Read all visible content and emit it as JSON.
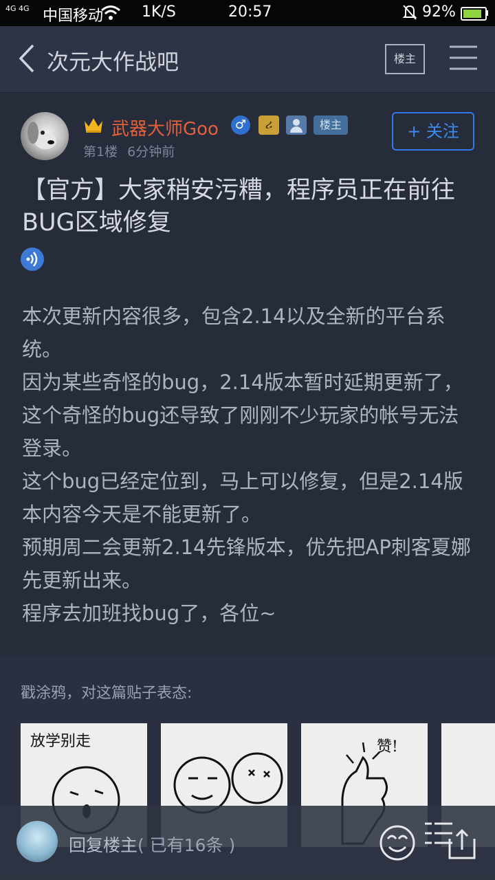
{
  "status_bar": {
    "signal": "4G 4G",
    "carrier": "中国移动",
    "speed": "1K/S",
    "time": "20:57",
    "battery": "92%"
  },
  "nav": {
    "title": "次元大作战吧",
    "louzhu_button": "楼主"
  },
  "post": {
    "author": "武器大师Goo",
    "badges": {
      "gender": "♂",
      "level": "ሪ",
      "louzhu": "楼主"
    },
    "floor": "第1楼",
    "time": "6分钟前",
    "follow_label": "+ 关注",
    "title": "【官方】大家稍安污糟，程序员正在前往BUG区域修复",
    "paragraphs": [
      "本次更新内容很多，包含2.14以及全新的平台系统。",
      "因为某些奇怪的bug，2.14版本暂时延期更新了，这个奇怪的bug还导致了刚刚不少玩家的帐号无法登录。",
      "这个bug已经定位到，马上可以修复，但是2.14版本内容今天是不能更新了。",
      "预期周二会更新2.14先锋版本，优先把AP刺客夏娜先更新出来。",
      "程序去加班找bug了，各位~"
    ]
  },
  "doodle": {
    "label": "戳涂鸦，对这篇贴子表态:",
    "stickers": [
      {
        "caption": "放学别走"
      },
      {
        "caption": ""
      },
      {
        "caption": "赞!"
      },
      {
        "caption": ""
      }
    ]
  },
  "reply_bar": {
    "label": "回复楼主",
    "count": "( 已有16条 )"
  }
}
